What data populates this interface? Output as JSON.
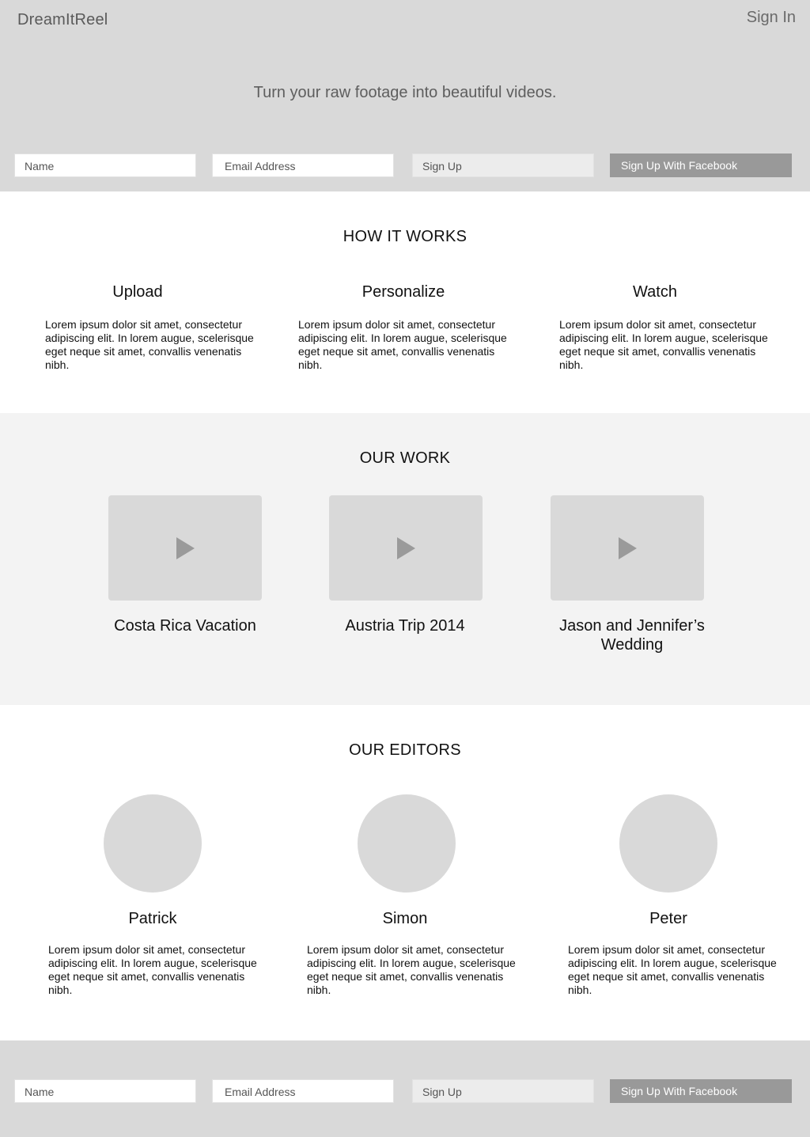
{
  "header": {
    "brand": "DreamItReel",
    "sign_in": "Sign In",
    "tagline": "Turn your raw footage into beautiful videos."
  },
  "signup_form": {
    "name_placeholder": "Name",
    "email_placeholder": "Email Address",
    "signup_label": "Sign Up",
    "facebook_label": "Sign Up With Facebook"
  },
  "how_it_works": {
    "title": "HOW IT WORKS",
    "steps": [
      {
        "title": "Upload",
        "text": "Lorem ipsum dolor sit amet, consectetur adipiscing elit. In lorem augue, scelerisque eget neque sit amet, convallis venenatis nibh."
      },
      {
        "title": "Personalize",
        "text": "Lorem ipsum dolor sit amet, consectetur adipiscing elit. In lorem augue, scelerisque eget neque sit amet, convallis venenatis nibh."
      },
      {
        "title": "Watch",
        "text": "Lorem ipsum dolor sit amet, consectetur adipiscing elit. In lorem augue, scelerisque eget neque sit amet, convallis venenatis nibh."
      }
    ]
  },
  "our_work": {
    "title": "OUR WORK",
    "videos": [
      {
        "title": "Costa Rica Vacation",
        "icon": "play-icon"
      },
      {
        "title": "Austria Trip 2014",
        "icon": "play-icon"
      },
      {
        "title": "Jason and Jennifer’s Wedding",
        "icon": "play-icon"
      }
    ]
  },
  "our_editors": {
    "title": "OUR EDITORS",
    "editors": [
      {
        "name": "Patrick",
        "bio": "Lorem ipsum dolor sit amet, consectetur adipiscing elit. In lorem augue, scelerisque eget neque sit amet, convallis venenatis nibh."
      },
      {
        "name": "Simon",
        "bio": "Lorem ipsum dolor sit amet, consectetur adipiscing elit. In lorem augue, scelerisque eget neque sit amet, convallis venenatis nibh."
      },
      {
        "name": "Peter",
        "bio": "Lorem ipsum dolor sit amet, consectetur adipiscing elit. In lorem augue, scelerisque eget neque sit amet, convallis venenatis nibh."
      }
    ]
  },
  "colors": {
    "hero_bg": "#d9d9d9",
    "work_bg": "#f3f3f3",
    "facebook_button": "#999999",
    "placeholder_gray": "#d9d9d9"
  }
}
